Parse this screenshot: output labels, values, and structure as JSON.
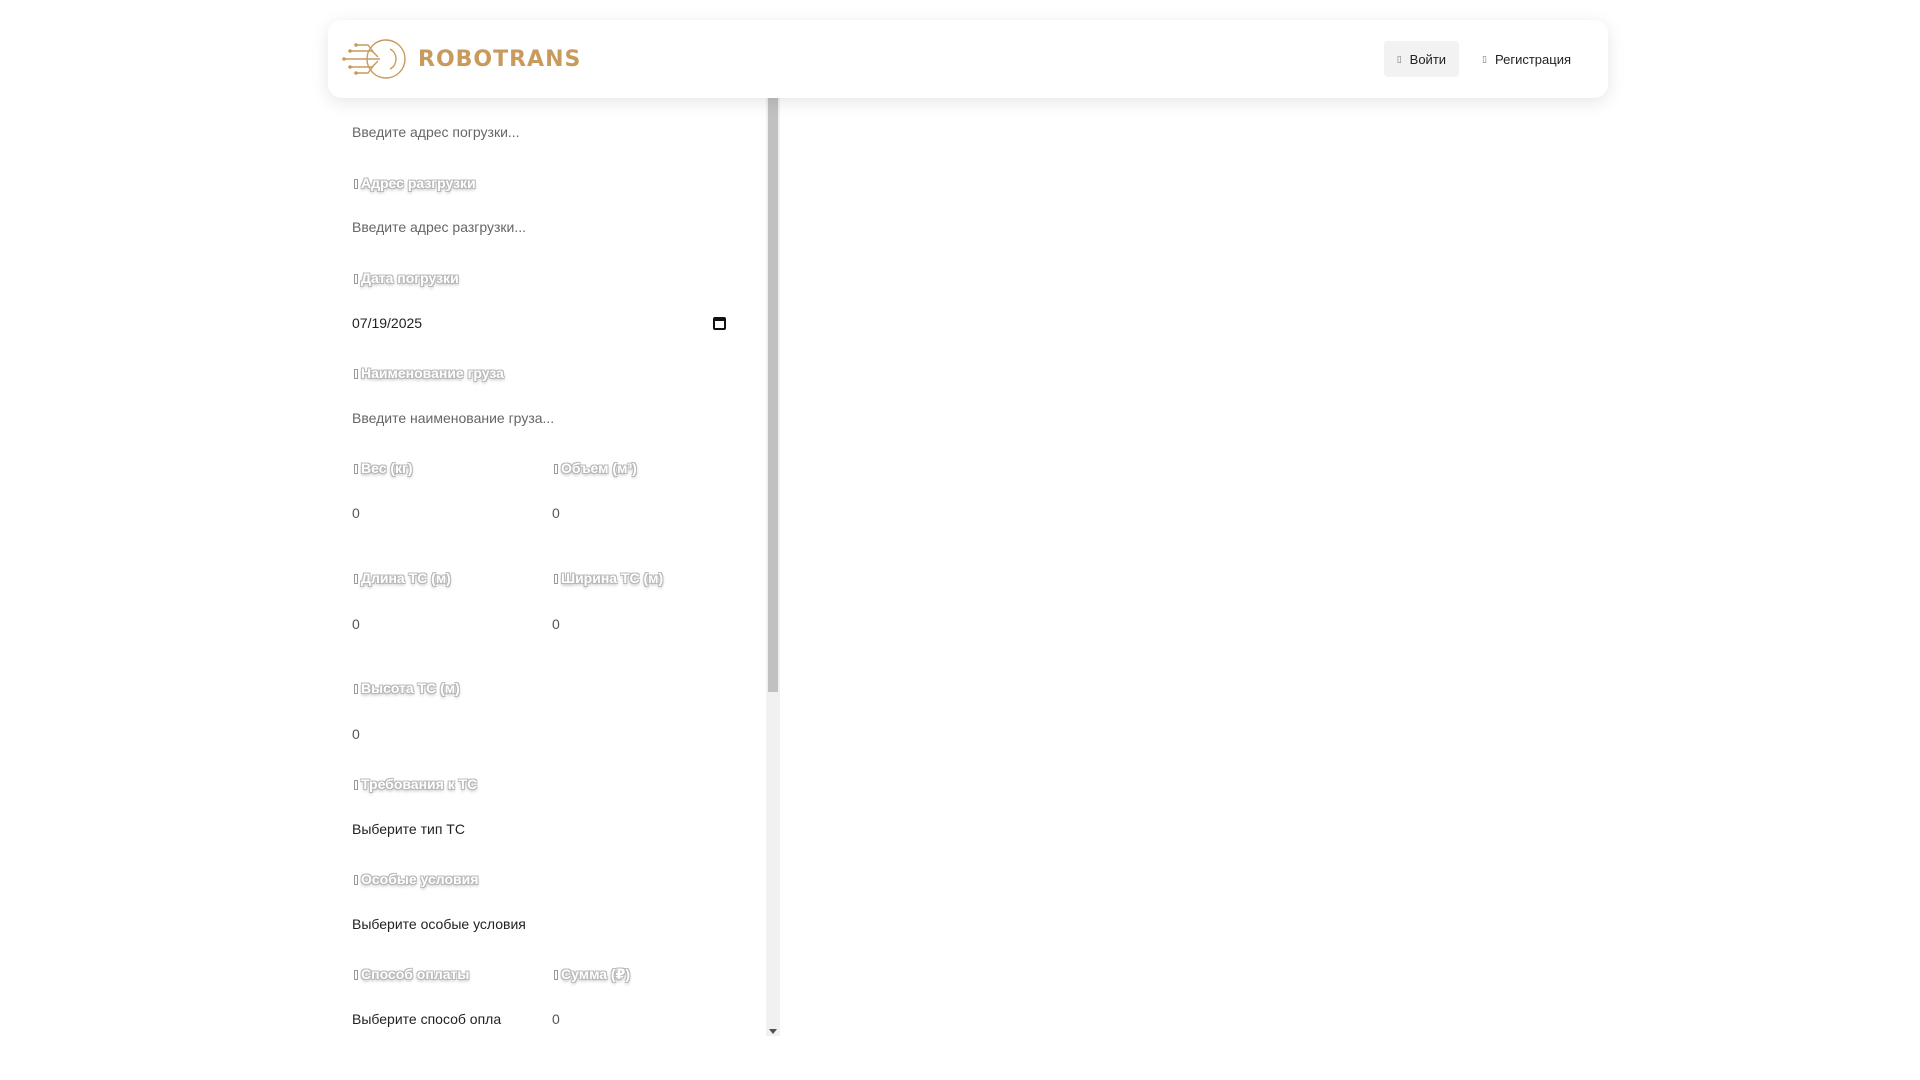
{
  "header": {
    "logo_text": "ROBOTRANS",
    "brand_color": "#c89a5c",
    "login_label": "Войти",
    "register_label": "Регистрация"
  },
  "form": {
    "loading_address": {
      "placeholder": "Введите адрес погрузки..."
    },
    "unloading_address": {
      "label": "Адрес разгрузки",
      "placeholder": "Введите адрес разгрузки..."
    },
    "loading_date": {
      "label": "Дата погрузки",
      "value": "07/19/2025"
    },
    "cargo_name": {
      "label": "Наименование груза",
      "placeholder": "Введите наименование груза..."
    },
    "weight": {
      "label": "Вес (кг)",
      "value": "0"
    },
    "volume": {
      "label": "Объем (м³)",
      "value": "0"
    },
    "vehicle_length": {
      "label": "Длина ТС (м)",
      "value": "0"
    },
    "vehicle_width": {
      "label": "Ширина ТС (м)",
      "value": "0"
    },
    "vehicle_height": {
      "label": "Высота ТС (м)",
      "value": "0"
    },
    "vehicle_requirements": {
      "label": "Требования к ТС",
      "value": "Выберите тип ТС"
    },
    "special_conditions": {
      "label": "Особые условия",
      "value": "Выберите особые условия"
    },
    "payment_method": {
      "label": "Способ оплаты",
      "value": "Выберите способ опла"
    },
    "amount": {
      "label": "Сумма (₽)",
      "value": "0"
    }
  }
}
